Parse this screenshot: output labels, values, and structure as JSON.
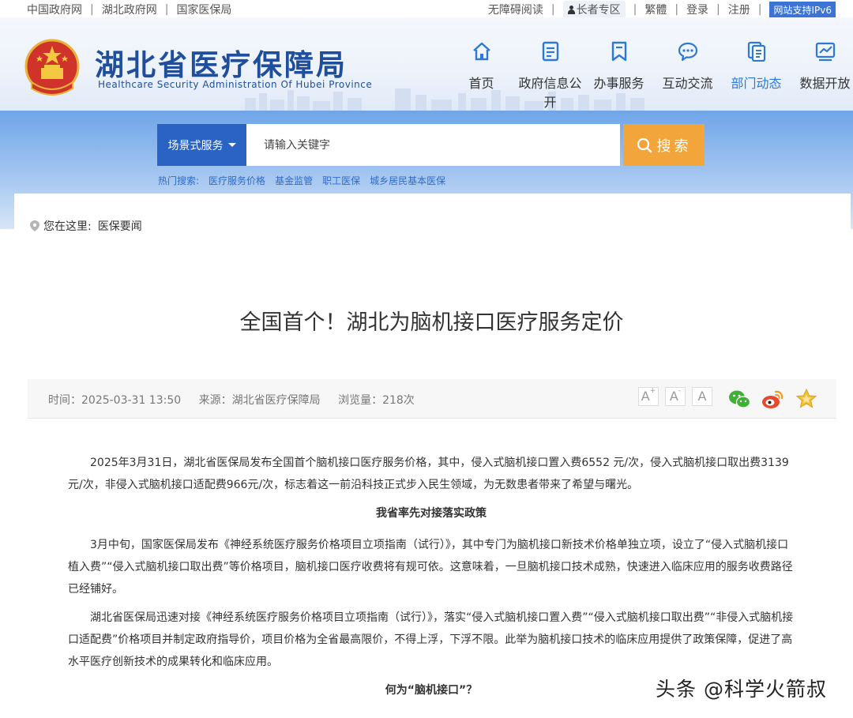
{
  "topbar": {
    "links": [
      "中国政府网",
      "湖北政府网",
      "国家医保局"
    ],
    "accessibility": "无障碍阅读",
    "elder": "长者专区",
    "traditional": "繁體",
    "login": "登录",
    "register": "注册",
    "ipv6": "网站支持IPv6"
  },
  "header": {
    "title": "湖北省医疗保障局",
    "subtitle": "Healthcare Security Administration Of Hubei Province",
    "nav": [
      {
        "label": "首页",
        "icon": "home-icon"
      },
      {
        "label": "政府信息公开",
        "icon": "document-icon"
      },
      {
        "label": "办事服务",
        "icon": "bookmark-icon"
      },
      {
        "label": "互动交流",
        "icon": "chat-icon"
      },
      {
        "label": "部门动态",
        "icon": "files-icon",
        "active": true
      },
      {
        "label": "数据开放",
        "icon": "chart-icon"
      }
    ]
  },
  "search": {
    "scene_label": "场景式服务",
    "placeholder": "请输入关键字",
    "button": "搜索",
    "hot_label": "热门搜索:",
    "hot_terms": [
      "医疗服务价格",
      "基金监管",
      "职工医保",
      "城乡居民基本医保"
    ]
  },
  "breadcrumb": {
    "here": "您在这里:",
    "section": "医保要闻"
  },
  "article": {
    "title": "全国首个！湖北为脑机接口医疗服务定价",
    "time": "时间：2025-03-31 13:50",
    "source": "来源：湖北省医疗保障局",
    "views": "浏览量：218次",
    "font_buttons": [
      "A",
      "A",
      "A"
    ],
    "font_sup": "+",
    "font_sub": "-",
    "paragraphs": [
      "2025年3月31日，湖北省医保局发布全国首个脑机接口医疗服务价格，其中，侵入式脑机接口置入费6552 元/次，侵入式脑机接口取出费3139元/次，非侵入式脑机接口适配费966元/次，标志着这一前沿科技正式步入民生领域，为无数患者带来了希望与曙光。",
      "我省率先对接落实政策",
      "3月中旬，国家医保局发布《神经系统医疗服务价格项目立项指南（试行）》，其中专门为脑机接口新技术价格单独立项，设立了“侵入式脑机接口植入费”“侵入式脑机接口取出费”等价格项目，脑机接口医疗收费将有规可依。这意味着，一旦脑机接口技术成熟，快速进入临床应用的服务收费路径已经铺好。",
      "湖北省医保局迅速对接《神经系统医疗服务价格项目立项指南（试行）》，落实“侵入式脑机接口置入费”“侵入式脑机接口取出费”“非侵入式脑机接口适配费”价格项目并制定政府指导价，项目价格为全省最高限价，不得上浮，下浮不限。此举为脑机接口技术的临床应用提供了政策保障，促进了高水平医疗创新技术的成果转化和临床应用。",
      "何为“脑机接口”？"
    ]
  },
  "watermark": "头条 @科学火箭叔"
}
